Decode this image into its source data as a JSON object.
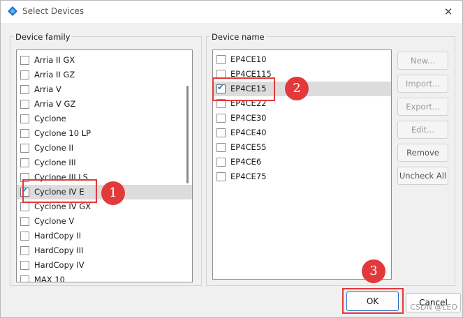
{
  "window": {
    "title": "Select Devices",
    "close_glyph": "✕",
    "icon": "app-diamond-icon"
  },
  "device_family": {
    "label": "Device family",
    "items": [
      {
        "label": "Arria II GX",
        "checked": false
      },
      {
        "label": "Arria II GZ",
        "checked": false
      },
      {
        "label": "Arria V",
        "checked": false
      },
      {
        "label": "Arria V GZ",
        "checked": false
      },
      {
        "label": "Cyclone",
        "checked": false
      },
      {
        "label": "Cyclone 10 LP",
        "checked": false
      },
      {
        "label": "Cyclone II",
        "checked": false
      },
      {
        "label": "Cyclone III",
        "checked": false
      },
      {
        "label": "Cyclone III LS",
        "checked": false
      },
      {
        "label": "Cyclone IV E",
        "checked": true,
        "selected": true
      },
      {
        "label": "Cyclone IV GX",
        "checked": false
      },
      {
        "label": "Cyclone V",
        "checked": false
      },
      {
        "label": "HardCopy II",
        "checked": false
      },
      {
        "label": "HardCopy III",
        "checked": false
      },
      {
        "label": "HardCopy IV",
        "checked": false
      },
      {
        "label": "MAX 10",
        "checked": false
      }
    ]
  },
  "device_name": {
    "label": "Device name",
    "items": [
      {
        "label": "EP4CE10",
        "checked": false
      },
      {
        "label": "EP4CE115",
        "checked": false
      },
      {
        "label": "EP4CE15",
        "checked": true,
        "selected": true
      },
      {
        "label": "EP4CE22",
        "checked": false
      },
      {
        "label": "EP4CE30",
        "checked": false
      },
      {
        "label": "EP4CE40",
        "checked": false
      },
      {
        "label": "EP4CE55",
        "checked": false
      },
      {
        "label": "EP4CE6",
        "checked": false
      },
      {
        "label": "EP4CE75",
        "checked": false
      }
    ]
  },
  "side_buttons": {
    "new": "New...",
    "import": "Import...",
    "export": "Export...",
    "edit": "Edit...",
    "remove": "Remove",
    "uncheck_all": "Uncheck All"
  },
  "dialog_buttons": {
    "ok": "OK",
    "cancel": "Cancel"
  },
  "annotations": {
    "one": "1",
    "two": "2",
    "three": "3"
  },
  "watermark": "CSDN @LEO",
  "colors": {
    "highlight": "#e23a3a",
    "check": "#1f7ad6",
    "selection": "#dcdcdc"
  }
}
